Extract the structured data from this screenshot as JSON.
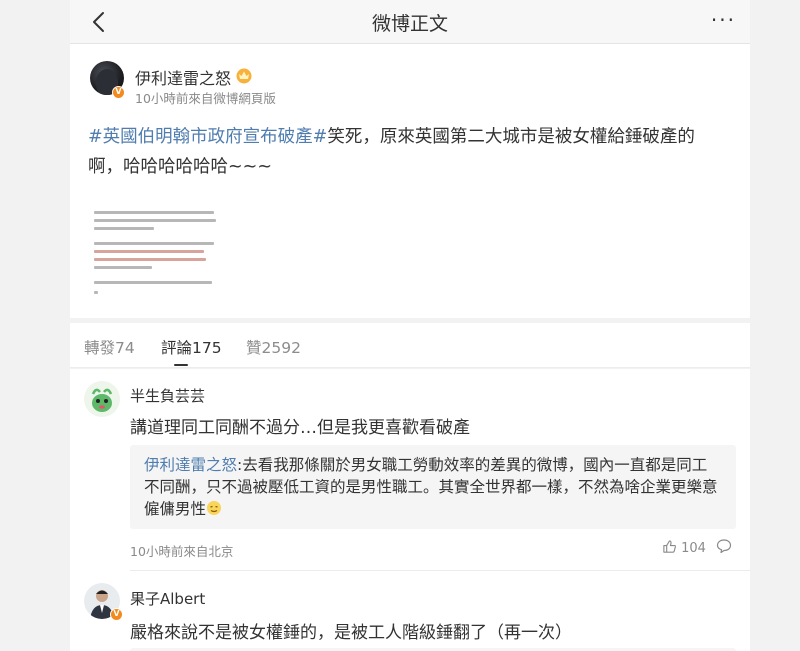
{
  "header": {
    "title": "微博正文",
    "more_label": "···"
  },
  "post": {
    "author": "伊利達雷之怒",
    "meta": "10小時前來自微博網頁版",
    "hashtag": "#英國伯明翰市政府宣布破產#",
    "text": "笑死，原來英國第二大城市是被女權給錘破產的啊，哈哈哈哈哈哈~~~",
    "verified_badge": "V"
  },
  "tabs": [
    {
      "label": "轉發74"
    },
    {
      "label": "評論175"
    },
    {
      "label": "贊2592"
    }
  ],
  "comments": [
    {
      "name": "半生負芸芸",
      "text": "講道理同工同酬不過分…但是我更喜歡看破產",
      "quote_name": "伊利達雷之怒",
      "quote_text": ":去看我那條關於男女職工勞動效率的差異的微博，國內一直都是同工不同酬，只不過被壓低工資的是男性職工。其實全世界都一樣，不然為啥企業更樂意僱傭男性",
      "time": "10小時前來自北京",
      "likes": "104"
    },
    {
      "name": "果子Albert",
      "text": "嚴格來說不是被女權錘的，是被工人階級錘翻了（再一次）"
    }
  ],
  "colors": {
    "link": "#507daf",
    "badge": "#f28a1e",
    "text": "#333333",
    "muted": "#8a8a8a"
  }
}
